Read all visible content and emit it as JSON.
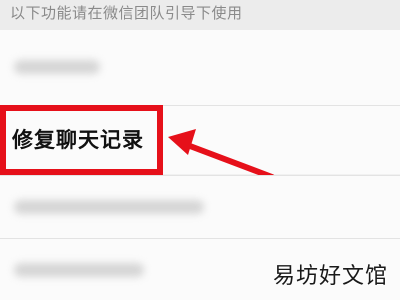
{
  "header": {
    "text": "以下功能请在微信团队引导下使用"
  },
  "menu": {
    "highlighted_item": "修复聊天记录"
  },
  "annotation": {
    "box_color": "#e6101a",
    "arrow_color": "#e6101a"
  },
  "watermark": {
    "text": "易坊好文馆"
  }
}
